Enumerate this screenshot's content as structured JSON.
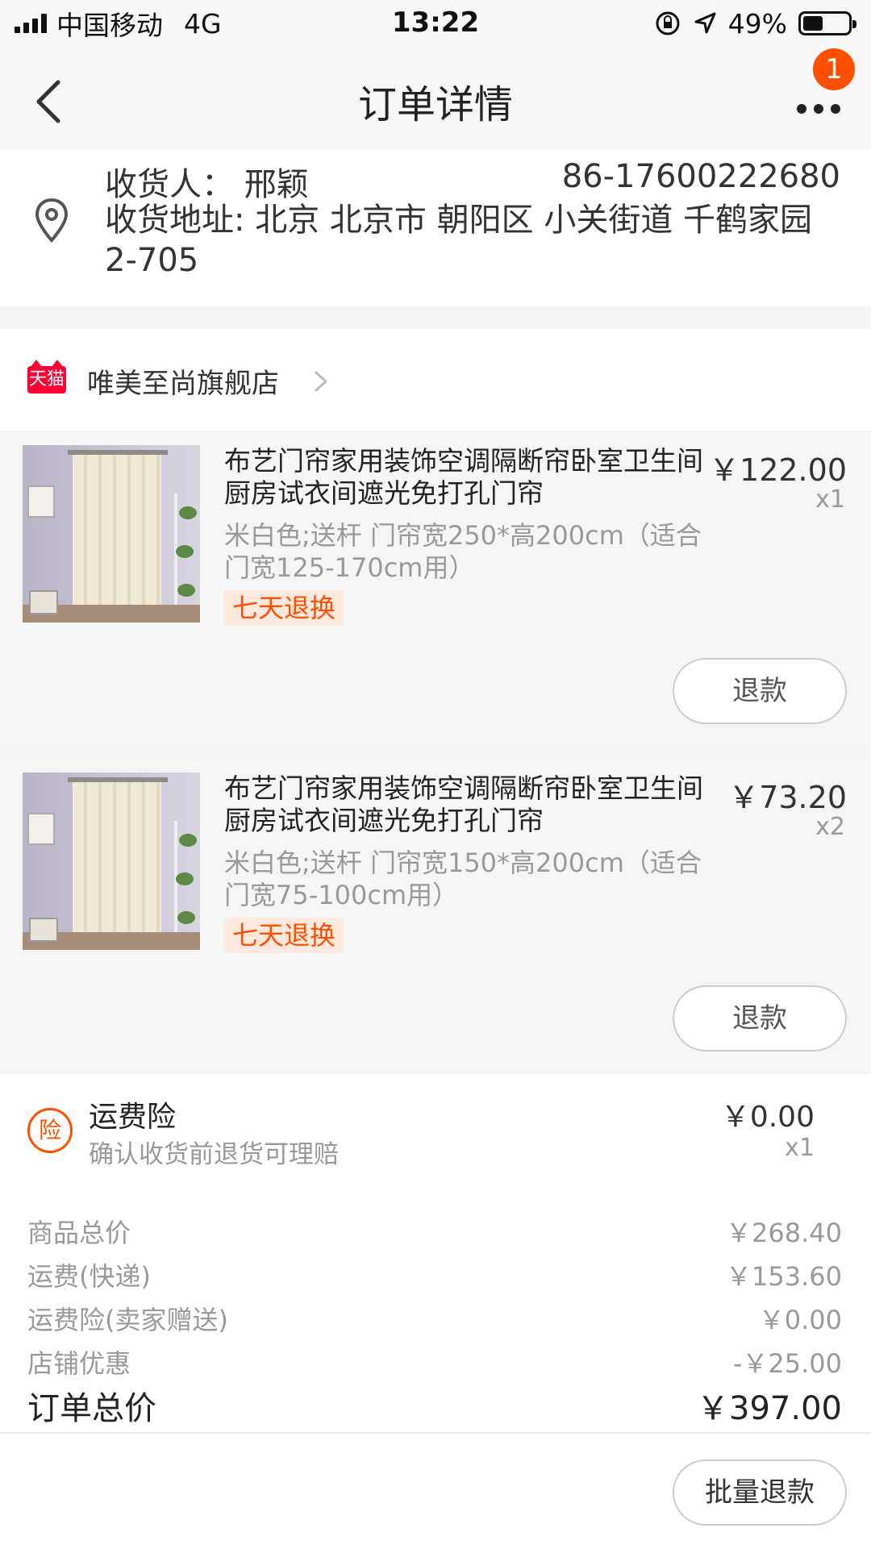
{
  "status": {
    "carrier": "中国移动",
    "network": "4G",
    "time": "13:22",
    "battery": "49%"
  },
  "nav": {
    "title": "订单详情",
    "badge": "1"
  },
  "address": {
    "recipient": "收货人：  邢颖",
    "phone": "86-17600222680",
    "address": "收货地址: 北京 北京市 朝阳区 小关街道 千鹤家园 2-705"
  },
  "shop": {
    "logo": "天猫",
    "name": "唯美至尚旗舰店"
  },
  "items": [
    {
      "title": "布艺门帘家用装饰空调隔断帘卧室卫生间厨房试衣间遮光免打孔门帘",
      "price": "￥122.00",
      "qty": "x1",
      "sku": "米白色;送杆 门帘宽250*高200cm（适合门宽125-170cm用）",
      "tag": "七天退换",
      "refund": "退款"
    },
    {
      "title": "布艺门帘家用装饰空调隔断帘卧室卫生间厨房试衣间遮光免打孔门帘",
      "price": "￥73.20",
      "qty": "x2",
      "sku": "米白色;送杆 门帘宽150*高200cm（适合门宽75-100cm用）",
      "tag": "七天退换",
      "refund": "退款"
    }
  ],
  "insurance": {
    "icon": "险",
    "label": "运费险",
    "desc": "确认收货前退货可理赔",
    "price": "￥0.00",
    "qty": "x1"
  },
  "summary": {
    "rows": [
      {
        "k": "商品总价",
        "v": "￥268.40"
      },
      {
        "k": "运费(快递)",
        "v": "￥153.60"
      },
      {
        "k": "运费险(卖家赠送)",
        "v": "￥0.00"
      },
      {
        "k": "店铺优惠",
        "v": "-￥25.00"
      }
    ],
    "total": {
      "k": "订单总价",
      "v": "￥397.00"
    }
  },
  "bottom": {
    "batch": "批量退款"
  },
  "colors": {
    "accent": "#ff5000",
    "tmall": "#ff0036"
  }
}
